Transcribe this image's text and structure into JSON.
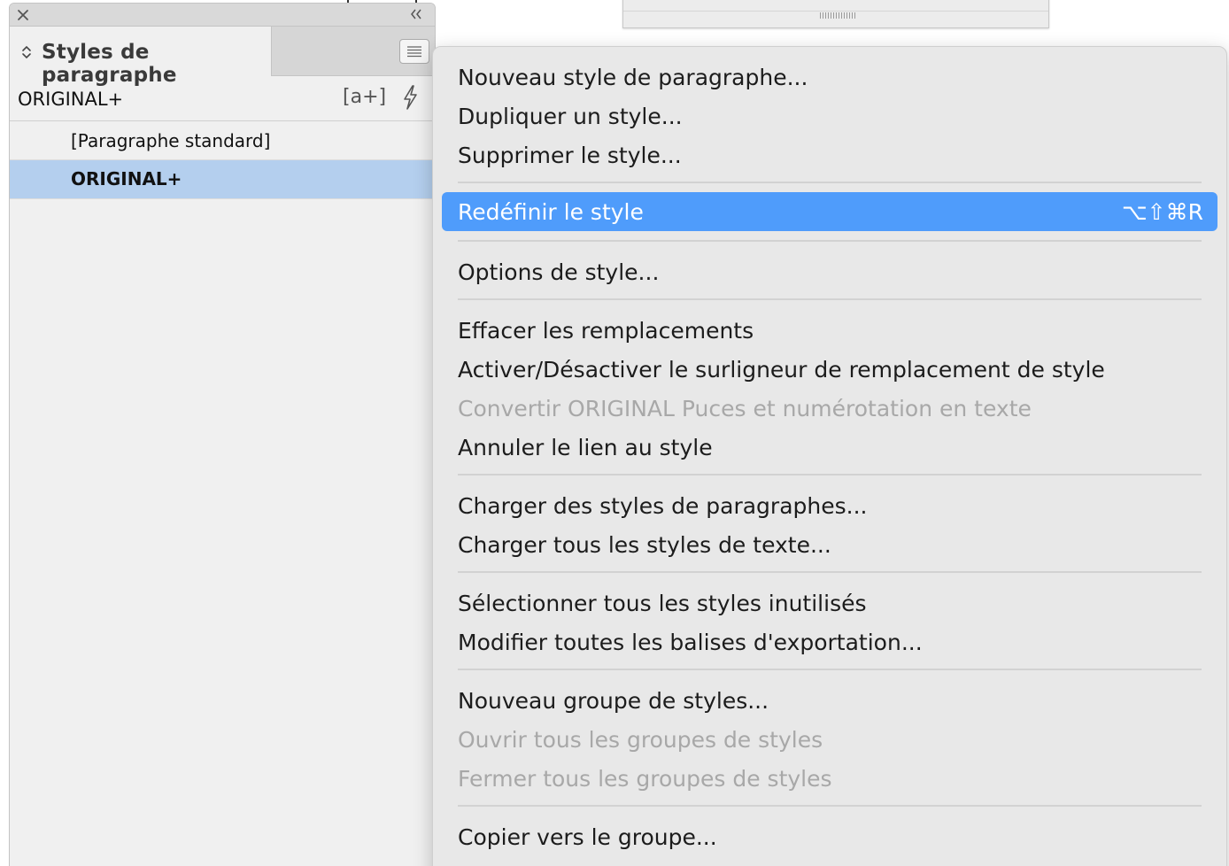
{
  "panel": {
    "tab_title": "Styles de paragraphe",
    "current_style": "ORIGINAL+",
    "new_override_label": "[a+]",
    "styles": [
      {
        "label": "[Paragraphe standard]",
        "selected": false
      },
      {
        "label": "ORIGINAL+",
        "selected": true
      }
    ]
  },
  "menu": {
    "items": [
      {
        "label": "Nouveau style de paragraphe..."
      },
      {
        "label": "Dupliquer un style..."
      },
      {
        "label": "Supprimer le style..."
      },
      {
        "label": "Redéfinir le style",
        "shortcut": "⌥⇧⌘R",
        "highlighted": true
      },
      {
        "label": "Options de style..."
      },
      {
        "label": "Effacer les remplacements"
      },
      {
        "label": "Activer/Désactiver le surligneur de remplacement de style"
      },
      {
        "label": "Convertir ORIGINAL Puces et numérotation en texte",
        "disabled": true
      },
      {
        "label": "Annuler le lien au style"
      },
      {
        "label": "Charger des styles de paragraphes..."
      },
      {
        "label": "Charger tous les styles de texte..."
      },
      {
        "label": "Sélectionner tous les styles inutilisés"
      },
      {
        "label": "Modifier toutes les balises d'exportation..."
      },
      {
        "label": "Nouveau groupe de styles..."
      },
      {
        "label": "Ouvrir tous les groupes de styles",
        "disabled": true
      },
      {
        "label": "Fermer tous les groupes de styles",
        "disabled": true
      },
      {
        "label": "Copier vers le groupe..."
      }
    ]
  },
  "colors": {
    "highlight": "#4f9cfb",
    "selected_row": "#b4cfee",
    "disabled_text": "#a8a8a8"
  }
}
